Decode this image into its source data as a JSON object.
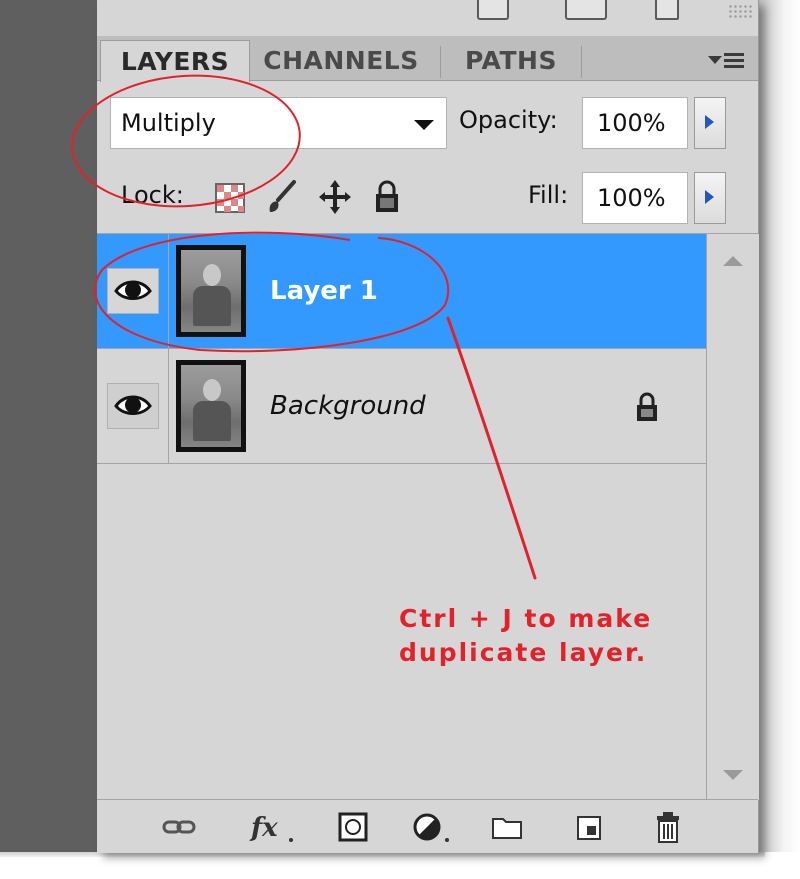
{
  "tabs": [
    {
      "label": "LAYERS",
      "active": true
    },
    {
      "label": "CHANNELS",
      "active": false
    },
    {
      "label": "PATHS",
      "active": false
    }
  ],
  "blend_mode": {
    "value": "Multiply"
  },
  "opacity": {
    "label": "Opacity:",
    "value": "100%"
  },
  "lock": {
    "label": "Lock:"
  },
  "fill": {
    "label": "Fill:",
    "value": "100%"
  },
  "layers": [
    {
      "name": "Layer 1",
      "selected": true,
      "visible": true,
      "locked": false
    },
    {
      "name": "Background",
      "selected": false,
      "visible": true,
      "locked": true
    }
  ],
  "annotation": {
    "line1": "Ctrl + J to make",
    "line2": "duplicate layer.",
    "color": "#e1222b"
  },
  "colors": {
    "selection": "#3399ff",
    "panel": "#d6d6d6",
    "annotation": "#e1222b"
  },
  "footer_icons": [
    "link-layers-icon",
    "fx-icon",
    "layer-mask-icon",
    "adjustment-layer-icon",
    "group-folder-icon",
    "new-layer-icon",
    "trash-icon"
  ]
}
